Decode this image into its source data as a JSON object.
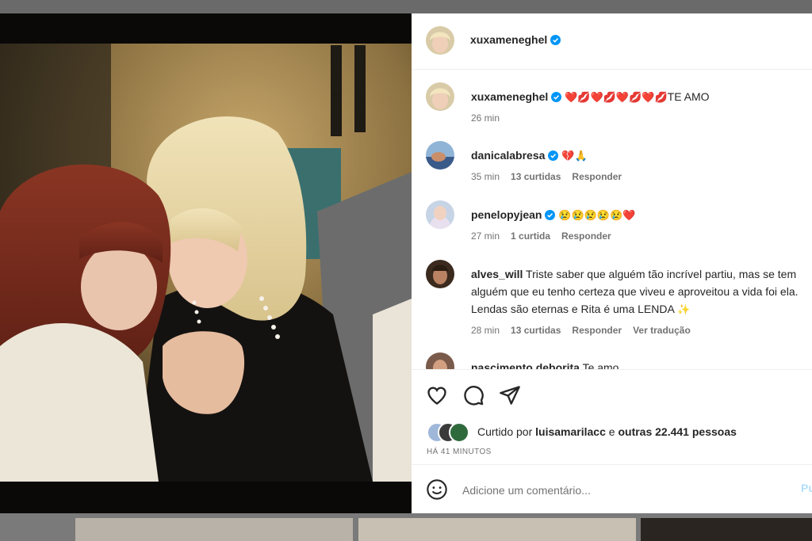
{
  "post": {
    "author": "xuxameneghel",
    "verified": true
  },
  "comments": [
    {
      "user": "xuxameneghel",
      "verified": true,
      "text": "",
      "emojis": [
        "❤️",
        "💋",
        "❤️",
        "💋",
        "❤️",
        "💋",
        "❤️",
        "💋"
      ],
      "suffix": "TE AMO",
      "time": "26 min"
    },
    {
      "user": "danicalabresa",
      "verified": true,
      "text": "",
      "emojis": [
        "💔",
        "🙏"
      ],
      "time": "35 min",
      "likes": "13 curtidas",
      "reply": "Responder"
    },
    {
      "user": "penelopyjean",
      "verified": true,
      "text": "",
      "emojis": [
        "😢",
        "😢",
        "😢",
        "😢",
        "😢",
        "❤️"
      ],
      "time": "27 min",
      "likes": "1 curtida",
      "reply": "Responder"
    },
    {
      "user": "alves_will",
      "verified": false,
      "text": "Triste saber que alguém tão incrível partiu, mas se tem alguém que eu tenho certeza que viveu e aproveitou a vida foi ela. Lendas são eternas e Rita é uma LENDA",
      "emojis": [
        "✨"
      ],
      "time": "28 min",
      "likes": "13 curtidas",
      "reply": "Responder",
      "translate": "Ver tradução"
    },
    {
      "user": "nascimento.deborita",
      "verified": false,
      "text": "Te amo"
    }
  ],
  "likes": {
    "prefix": "Curtido por",
    "user": "luisamarilacc",
    "middle": "e",
    "others": "outras 22.441 pessoas"
  },
  "timestamp": "HÁ 41 MINUTOS",
  "composer": {
    "placeholder": "Adicione um comentário...",
    "post_label": "Pu"
  },
  "icons": [
    "heart-icon",
    "comment-icon",
    "share-icon",
    "smile-icon",
    "verified-icon"
  ],
  "colors": {
    "verified": "#0095f6",
    "post_btn": "#b2dffc",
    "text": "#262626",
    "muted": "#737373"
  }
}
